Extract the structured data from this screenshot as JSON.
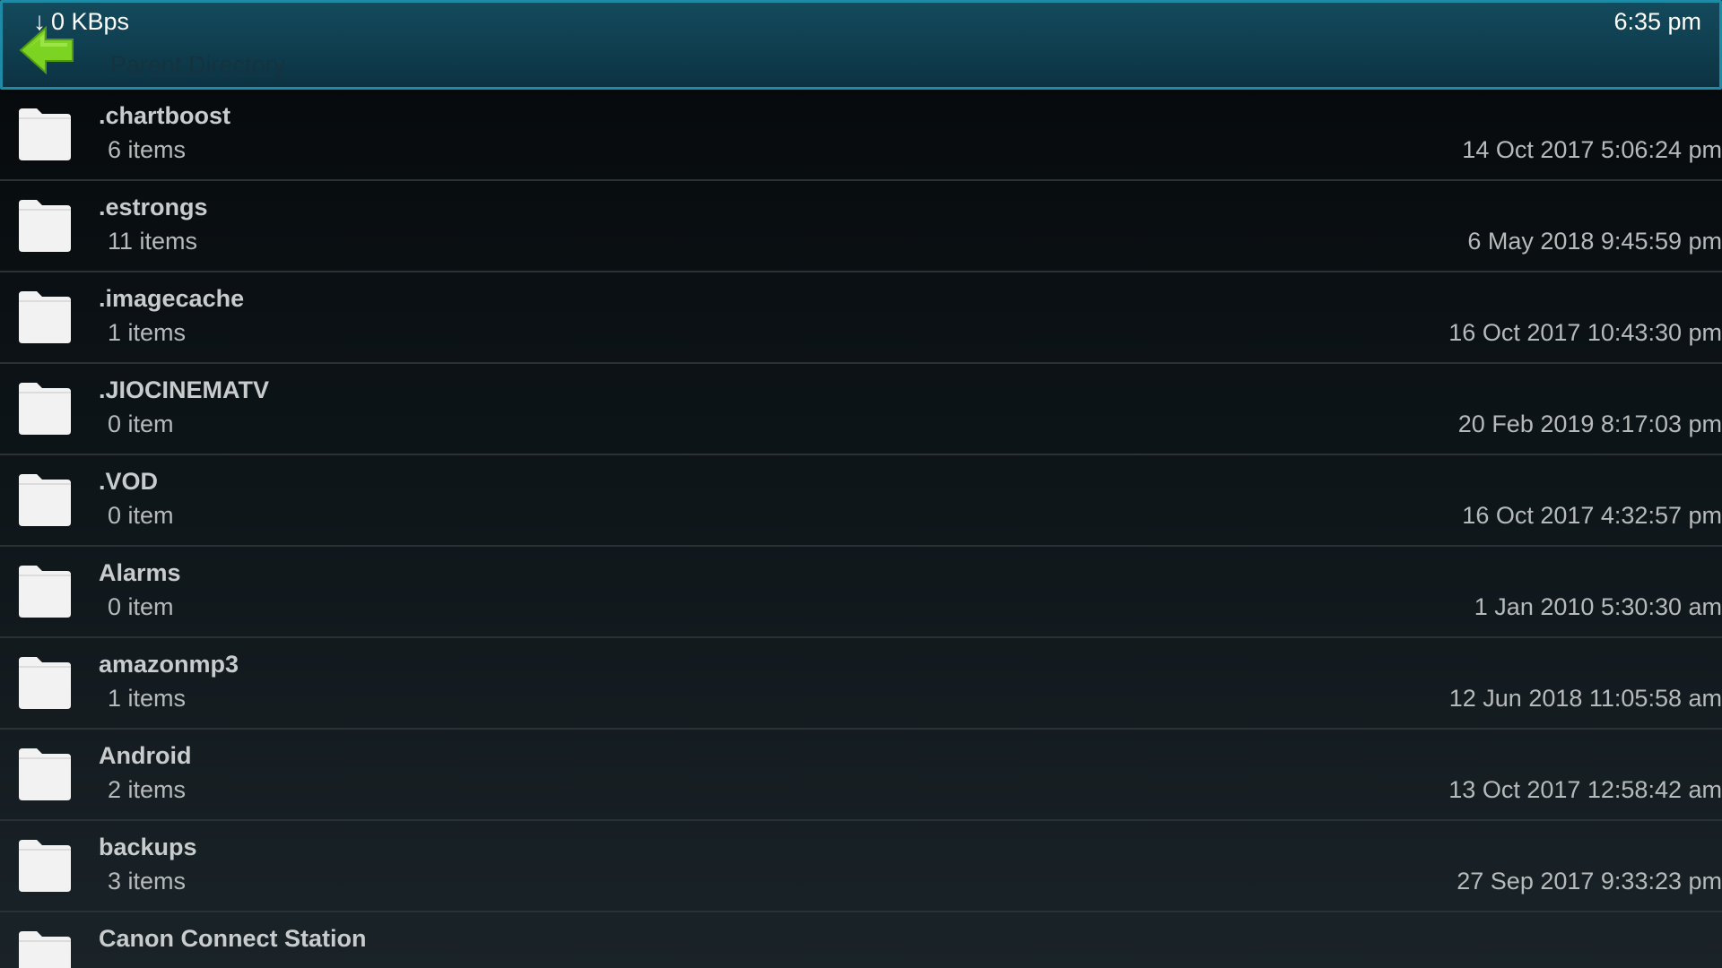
{
  "status_bar": {
    "download_speed": "0 KBps",
    "time": "6:35 pm"
  },
  "parent_row": {
    "label": "Parent Directory",
    "icon": "back-arrow-icon"
  },
  "colors": {
    "highlight_border": "#1d8aa6",
    "highlight_fill": "#0f3e4f",
    "back_arrow": "#7dd321",
    "folder": "#f2f2f2",
    "text": "#c9cccd"
  },
  "files": [
    {
      "name": ".chartboost",
      "count": "6 items",
      "date": "14 Oct 2017 5:06:24 pm",
      "icon": "folder-icon"
    },
    {
      "name": ".estrongs",
      "count": "11 items",
      "date": "6 May 2018 9:45:59 pm",
      "icon": "folder-icon"
    },
    {
      "name": ".imagecache",
      "count": "1 items",
      "date": "16 Oct 2017 10:43:30 pm",
      "icon": "folder-icon"
    },
    {
      "name": ".JIOCINEMATV",
      "count": "0 item",
      "date": "20 Feb 2019 8:17:03 pm",
      "icon": "folder-icon"
    },
    {
      "name": ".VOD",
      "count": "0 item",
      "date": "16 Oct 2017 4:32:57 pm",
      "icon": "folder-icon"
    },
    {
      "name": "Alarms",
      "count": "0 item",
      "date": "1 Jan 2010 5:30:30 am",
      "icon": "folder-icon"
    },
    {
      "name": "amazonmp3",
      "count": "1 items",
      "date": "12 Jun 2018 11:05:58 am",
      "icon": "folder-icon"
    },
    {
      "name": "Android",
      "count": "2 items",
      "date": "13 Oct 2017 12:58:42 am",
      "icon": "folder-icon"
    },
    {
      "name": "backups",
      "count": "3 items",
      "date": "27 Sep 2017 9:33:23 pm",
      "icon": "folder-icon"
    },
    {
      "name": "Canon Connect Station",
      "count": "",
      "date": "",
      "icon": "folder-icon"
    }
  ]
}
